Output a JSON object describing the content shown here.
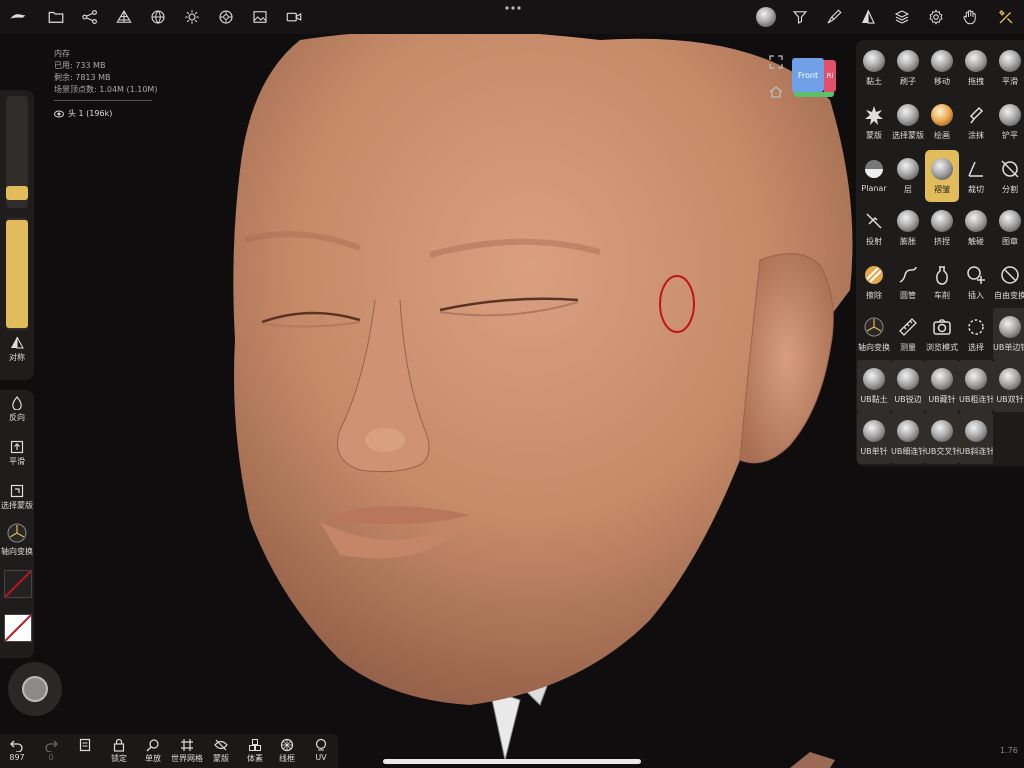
{
  "memory": {
    "title": "内存",
    "used": "已用: 733 MB",
    "free": "剩余: 7813 MB",
    "vertices": "场景顶点数: 1.04M (1.10M)"
  },
  "object": {
    "label": "头 1 (196k)"
  },
  "left_panel": {
    "symmetry": "对称",
    "invert": "反向",
    "smooth": "平滑",
    "select_mask": "选择蒙版",
    "axis_transform": "轴向变换"
  },
  "view_cube": {
    "front": "Front",
    "side": "Ri"
  },
  "tools": [
    {
      "label": "黏土",
      "icon": "sphere"
    },
    {
      "label": "刷子",
      "icon": "sphere"
    },
    {
      "label": "移动",
      "icon": "sphere"
    },
    {
      "label": "拖拽",
      "icon": "sphere"
    },
    {
      "label": "平滑",
      "icon": "sphere"
    },
    {
      "label": "蒙版",
      "icon": "splat"
    },
    {
      "label": "选择蒙版",
      "icon": "sphere"
    },
    {
      "label": "绘画",
      "icon": "paint-sphere"
    },
    {
      "label": "涂抹",
      "icon": "smudge"
    },
    {
      "label": "铲平",
      "icon": "sphere"
    },
    {
      "label": "Planar",
      "icon": "half"
    },
    {
      "label": "层",
      "icon": "sphere"
    },
    {
      "label": "褶皱",
      "icon": "sphere"
    },
    {
      "label": "裁切",
      "icon": "trim"
    },
    {
      "label": "分割",
      "icon": "split"
    },
    {
      "label": "投射",
      "icon": "project"
    },
    {
      "label": "膨胀",
      "icon": "sphere"
    },
    {
      "label": "挤捏",
      "icon": "sphere"
    },
    {
      "label": "触碰",
      "icon": "sphere"
    },
    {
      "label": "图章",
      "icon": "sphere"
    },
    {
      "label": "擦除",
      "icon": "erase"
    },
    {
      "label": "圆管",
      "icon": "tube"
    },
    {
      "label": "车削",
      "icon": "lathe"
    },
    {
      "label": "插入",
      "icon": "insert"
    },
    {
      "label": "自由变换",
      "icon": "transform"
    },
    {
      "label": "轴向变换",
      "icon": "gizmo"
    },
    {
      "label": "测量",
      "icon": "ruler"
    },
    {
      "label": "浏览模式",
      "icon": "camera"
    },
    {
      "label": "选择",
      "icon": "lasso"
    },
    {
      "label": "UB单边针",
      "icon": "sphere"
    },
    {
      "label": "UB黏土",
      "icon": "sphere"
    },
    {
      "label": "UB锐边",
      "icon": "sphere"
    },
    {
      "label": "UB藏针",
      "icon": "sphere"
    },
    {
      "label": "UB粗连针",
      "icon": "sphere"
    },
    {
      "label": "UB双针",
      "icon": "sphere"
    },
    {
      "label": "UB单针",
      "icon": "sphere"
    },
    {
      "label": "UB细连针",
      "icon": "sphere"
    },
    {
      "label": "UB交叉针",
      "icon": "sphere"
    },
    {
      "label": "UB斜连针",
      "icon": "sphere"
    }
  ],
  "bottom": {
    "undo_count": "897",
    "redo_count": "0",
    "lock": "锁定",
    "solo": "单放",
    "world_grid": "世界网格",
    "mask": "蒙版",
    "voxel": "体素",
    "wireframe": "线框",
    "uv": "UV"
  },
  "version": "1.76",
  "colors": {
    "accent": "#e2bc5b",
    "panel": "#1e1c1b",
    "skin": "#c98d6c",
    "stroke_circle": "#c0141e"
  }
}
